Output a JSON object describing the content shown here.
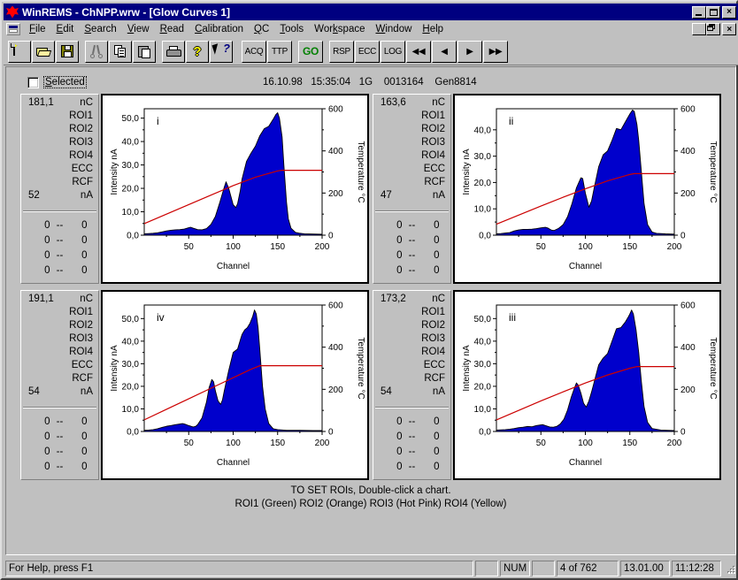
{
  "window": {
    "title": "WinREMS - ChNPP.wrw - [Glow Curves 1]",
    "icon": "app-bug-icon",
    "minimize_label": "_",
    "maximize_label": "",
    "close_label": "×"
  },
  "menu": {
    "items": [
      {
        "label": "File",
        "accel": "F"
      },
      {
        "label": "Edit",
        "accel": "E"
      },
      {
        "label": "Search",
        "accel": "S"
      },
      {
        "label": "View",
        "accel": "V"
      },
      {
        "label": "Read",
        "accel": "R"
      },
      {
        "label": "Calibration",
        "accel": "C"
      },
      {
        "label": "QC",
        "accel": "Q"
      },
      {
        "label": "Tools",
        "accel": "T"
      },
      {
        "label": "Workspace",
        "accel": "k"
      },
      {
        "label": "Window",
        "accel": "W"
      },
      {
        "label": "Help",
        "accel": "H"
      }
    ]
  },
  "toolbar": {
    "buttons": [
      {
        "name": "new",
        "icon": "new-document-icon",
        "label": ""
      },
      {
        "name": "open",
        "icon": "open-folder-icon",
        "label": ""
      },
      {
        "name": "save",
        "icon": "save-disk-icon",
        "label": ""
      },
      {
        "name": "cut",
        "icon": "scissors-icon",
        "label": ""
      },
      {
        "name": "copy",
        "icon": "copy-icon",
        "label": ""
      },
      {
        "name": "paste",
        "icon": "clipboard-paste-icon",
        "label": ""
      },
      {
        "name": "print",
        "icon": "printer-icon",
        "label": ""
      },
      {
        "name": "about",
        "icon": "question-mark-icon",
        "label": ""
      },
      {
        "name": "context-help",
        "icon": "arrow-question-icon",
        "label": ""
      }
    ],
    "acq_label": "ACQ",
    "ttp_label": "TTP",
    "go_label": "GO",
    "go_color": "#008000",
    "rsp_label": "RSP",
    "ecc_label": "ECC",
    "log_label": "LOG",
    "first_label": "◀◀",
    "prev_label": "◀",
    "next_label": "▶",
    "last_label": "▶▶"
  },
  "client": {
    "selected_checkbox_label": "Selected",
    "selected_checked": false,
    "header_info": "16.10.98   15:35:04   1G    0013164    Gen8814",
    "note_line1": "TO SET ROIs, Double-click a chart.",
    "note_line2": "ROI1 (Green)      ROI2 (Orange)    ROI3 (Hot Pink)  ROI4 (Yellow)"
  },
  "panels": [
    {
      "id": "panel-i",
      "charge": "181,1",
      "charge_unit": "nC",
      "roi_labels": [
        "ROI1",
        "ROI2",
        "ROI3",
        "ROI4",
        "ECC",
        "RCF"
      ],
      "current": "52",
      "current_unit": "nA",
      "roi_rows": [
        {
          "from": "0",
          "dash": "--",
          "to": "0"
        },
        {
          "from": "0",
          "dash": "--",
          "to": "0"
        },
        {
          "from": "0",
          "dash": "--",
          "to": "0"
        },
        {
          "from": "0",
          "dash": "--",
          "to": "0"
        }
      ]
    },
    {
      "id": "panel-ii",
      "charge": "163,6",
      "charge_unit": "nC",
      "roi_labels": [
        "ROI1",
        "ROI2",
        "ROI3",
        "ROI4",
        "ECC",
        "RCF"
      ],
      "current": "47",
      "current_unit": "nA",
      "roi_rows": [
        {
          "from": "0",
          "dash": "--",
          "to": "0"
        },
        {
          "from": "0",
          "dash": "--",
          "to": "0"
        },
        {
          "from": "0",
          "dash": "--",
          "to": "0"
        },
        {
          "from": "0",
          "dash": "--",
          "to": "0"
        }
      ]
    },
    {
      "id": "panel-iv",
      "charge": "191,1",
      "charge_unit": "nC",
      "roi_labels": [
        "ROI1",
        "ROI2",
        "ROI3",
        "ROI4",
        "ECC",
        "RCF"
      ],
      "current": "54",
      "current_unit": "nA",
      "roi_rows": [
        {
          "from": "0",
          "dash": "--",
          "to": "0"
        },
        {
          "from": "0",
          "dash": "--",
          "to": "0"
        },
        {
          "from": "0",
          "dash": "--",
          "to": "0"
        },
        {
          "from": "0",
          "dash": "--",
          "to": "0"
        }
      ]
    },
    {
      "id": "panel-iii",
      "charge": "173,2",
      "charge_unit": "nC",
      "roi_labels": [
        "ROI1",
        "ROI2",
        "ROI3",
        "ROI4",
        "ECC",
        "RCF"
      ],
      "current": "54",
      "current_unit": "nA",
      "roi_rows": [
        {
          "from": "0",
          "dash": "--",
          "to": "0"
        },
        {
          "from": "0",
          "dash": "--",
          "to": "0"
        },
        {
          "from": "0",
          "dash": "--",
          "to": "0"
        },
        {
          "from": "0",
          "dash": "--",
          "to": "0"
        }
      ]
    }
  ],
  "statusbar": {
    "help_text": "For Help, press F1",
    "blank1": "",
    "num": "NUM",
    "blank2": "",
    "record": "4 of 762",
    "date": "13.01.00",
    "time": "11:12:28"
  },
  "chart_data": [
    {
      "type": "area",
      "id": "i",
      "annotation": "i",
      "title": "",
      "xlabel": "Channel",
      "ylabel": "Intensity nA",
      "y2label": "Temperature °C",
      "xlim": [
        0,
        200
      ],
      "ylim": [
        0,
        54
      ],
      "y2lim": [
        0,
        600
      ],
      "xticks": [
        50,
        100,
        150,
        200
      ],
      "yticks": [
        "0,0",
        "10,0",
        "20,0",
        "30,0",
        "40,0",
        "50,0"
      ],
      "y2ticks": [
        0,
        200,
        400,
        600
      ],
      "grid": false,
      "series": [
        {
          "name": "Intensity",
          "color": "#0000cc",
          "x": [
            0,
            5,
            10,
            15,
            20,
            25,
            30,
            35,
            40,
            45,
            50,
            52,
            55,
            60,
            65,
            70,
            75,
            80,
            85,
            90,
            92,
            95,
            100,
            103,
            105,
            108,
            110,
            115,
            120,
            125,
            130,
            135,
            140,
            145,
            148,
            150,
            152,
            155,
            157,
            160,
            162,
            165,
            170,
            175,
            180,
            190,
            200
          ],
          "values": [
            0.6,
            0.7,
            0.8,
            1.0,
            1.4,
            1.8,
            2.1,
            2.3,
            2.4,
            2.6,
            3.2,
            3.4,
            3.0,
            2.4,
            2.3,
            2.8,
            4.6,
            8.0,
            14.0,
            20.5,
            22.8,
            20.0,
            13.0,
            11.8,
            13.5,
            19.0,
            24.0,
            31.5,
            35.0,
            38.0,
            42.5,
            45.5,
            46.5,
            49.5,
            51.5,
            52.3,
            50.0,
            42.0,
            30.0,
            14.0,
            7.0,
            3.0,
            1.2,
            0.8,
            0.6,
            0.5,
            0.4
          ]
        },
        {
          "name": "Temperature",
          "color": "#cc0000",
          "x": [
            0,
            25,
            50,
            75,
            100,
            125,
            150,
            155,
            175,
            200
          ],
          "values": [
            55,
            100,
            145,
            190,
            235,
            275,
            305,
            308,
            308,
            308
          ]
        }
      ]
    },
    {
      "type": "area",
      "id": "ii",
      "annotation": "ii",
      "title": "",
      "xlabel": "Channel",
      "ylabel": "Intensity nA",
      "y2label": "Temperature °C",
      "xlim": [
        0,
        200
      ],
      "ylim": [
        0,
        48
      ],
      "y2lim": [
        0,
        600
      ],
      "xticks": [
        50,
        100,
        150,
        200
      ],
      "yticks": [
        "0,0",
        "10,0",
        "20,0",
        "30,0",
        "40,0"
      ],
      "y2ticks": [
        0,
        200,
        400,
        600
      ],
      "grid": false,
      "series": [
        {
          "name": "Intensity",
          "color": "#0000cc",
          "x": [
            0,
            5,
            10,
            15,
            20,
            25,
            30,
            35,
            40,
            45,
            50,
            55,
            58,
            62,
            65,
            70,
            75,
            80,
            85,
            90,
            95,
            97,
            100,
            104,
            107,
            110,
            115,
            120,
            125,
            130,
            135,
            140,
            145,
            150,
            153,
            155,
            158,
            160,
            163,
            166,
            170,
            175,
            180,
            190,
            200
          ],
          "values": [
            0.5,
            0.6,
            0.8,
            1.0,
            1.6,
            2.0,
            2.2,
            2.2,
            2.3,
            2.5,
            2.8,
            3.0,
            2.7,
            1.9,
            1.8,
            2.6,
            4.0,
            7.0,
            12.0,
            18.0,
            21.8,
            21.5,
            16.0,
            10.6,
            13.0,
            18.0,
            26.0,
            30.5,
            32.0,
            36.0,
            40.5,
            40.0,
            43.0,
            46.0,
            47.5,
            47.0,
            42.0,
            36.0,
            24.0,
            12.0,
            4.0,
            1.2,
            0.7,
            0.5,
            0.4
          ]
        },
        {
          "name": "Temperature",
          "color": "#cc0000",
          "x": [
            0,
            25,
            50,
            75,
            100,
            125,
            150,
            155,
            175,
            200
          ],
          "values": [
            52,
            95,
            138,
            180,
            220,
            258,
            288,
            292,
            292,
            292
          ]
        }
      ]
    },
    {
      "type": "area",
      "id": "iv",
      "annotation": "iv",
      "title": "",
      "xlabel": "Channel",
      "ylabel": "Intensity nA",
      "y2label": "Temperature °C",
      "xlim": [
        0,
        200
      ],
      "ylim": [
        0,
        56
      ],
      "y2lim": [
        0,
        600
      ],
      "xticks": [
        50,
        100,
        150,
        200
      ],
      "yticks": [
        "0,0",
        "10,0",
        "20,0",
        "30,0",
        "40,0",
        "50,0"
      ],
      "y2ticks": [
        0,
        200,
        400,
        600
      ],
      "grid": false,
      "series": [
        {
          "name": "Intensity",
          "color": "#0000cc",
          "x": [
            0,
            5,
            10,
            15,
            20,
            25,
            30,
            35,
            40,
            43,
            46,
            50,
            55,
            58,
            60,
            65,
            70,
            73,
            76,
            78,
            80,
            83,
            86,
            88,
            90,
            95,
            100,
            105,
            108,
            110,
            113,
            116,
            119,
            122,
            124,
            126,
            128,
            130,
            133,
            136,
            140,
            145,
            150,
            160,
            175,
            190,
            200
          ],
          "values": [
            0.5,
            0.6,
            0.8,
            1.2,
            1.8,
            2.3,
            2.6,
            3.0,
            3.3,
            3.5,
            3.2,
            2.6,
            2.0,
            2.3,
            3.0,
            6.0,
            13.0,
            19.5,
            23.0,
            22.0,
            18.0,
            13.5,
            12.0,
            14.0,
            18.0,
            27.0,
            35.0,
            36.5,
            40.5,
            43.0,
            45.0,
            46.0,
            48.0,
            51.0,
            53.8,
            52.0,
            46.0,
            36.0,
            20.0,
            10.0,
            3.5,
            1.2,
            0.8,
            0.5,
            0.5,
            0.4,
            0.4
          ]
        },
        {
          "name": "Temperature",
          "color": "#cc0000",
          "x": [
            0,
            25,
            50,
            75,
            100,
            120,
            130,
            150,
            175,
            200
          ],
          "values": [
            55,
            105,
            155,
            205,
            255,
            295,
            312,
            312,
            312,
            312
          ]
        }
      ]
    },
    {
      "type": "area",
      "id": "iii",
      "annotation": "iii",
      "title": "",
      "xlabel": "Channel",
      "ylabel": "Intensity nA",
      "y2label": "Temperature °C",
      "xlim": [
        0,
        200
      ],
      "ylim": [
        0,
        56
      ],
      "y2lim": [
        0,
        600
      ],
      "xticks": [
        50,
        100,
        150,
        200
      ],
      "yticks": [
        "0,0",
        "10,0",
        "20,0",
        "30,0",
        "40,0",
        "50,0"
      ],
      "y2ticks": [
        0,
        200,
        400,
        600
      ],
      "grid": false,
      "series": [
        {
          "name": "Intensity",
          "color": "#0000cc",
          "x": [
            0,
            5,
            10,
            15,
            20,
            25,
            30,
            35,
            40,
            45,
            50,
            52,
            55,
            60,
            64,
            68,
            72,
            76,
            80,
            84,
            88,
            90,
            92,
            95,
            98,
            101,
            104,
            107,
            110,
            115,
            120,
            125,
            130,
            135,
            140,
            145,
            148,
            150,
            152,
            154,
            157,
            160,
            163,
            166,
            170,
            175,
            185,
            200
          ],
          "values": [
            0.6,
            0.7,
            0.8,
            1.0,
            1.3,
            1.7,
            1.9,
            2.2,
            2.1,
            2.6,
            2.9,
            3.0,
            2.6,
            2.0,
            1.9,
            2.3,
            3.4,
            5.5,
            9.5,
            15.0,
            19.5,
            21.5,
            20.5,
            17.0,
            12.5,
            10.8,
            13.5,
            17.5,
            22.0,
            29.5,
            32.5,
            34.5,
            40.0,
            45.5,
            46.0,
            48.5,
            50.5,
            52.0,
            53.8,
            52.0,
            45.0,
            35.0,
            22.0,
            11.0,
            4.0,
            1.3,
            0.6,
            0.4
          ]
        },
        {
          "name": "Temperature",
          "color": "#cc0000",
          "x": [
            0,
            25,
            50,
            75,
            100,
            125,
            150,
            158,
            175,
            200
          ],
          "values": [
            55,
            100,
            145,
            188,
            230,
            268,
            300,
            308,
            308,
            308
          ]
        }
      ]
    }
  ]
}
